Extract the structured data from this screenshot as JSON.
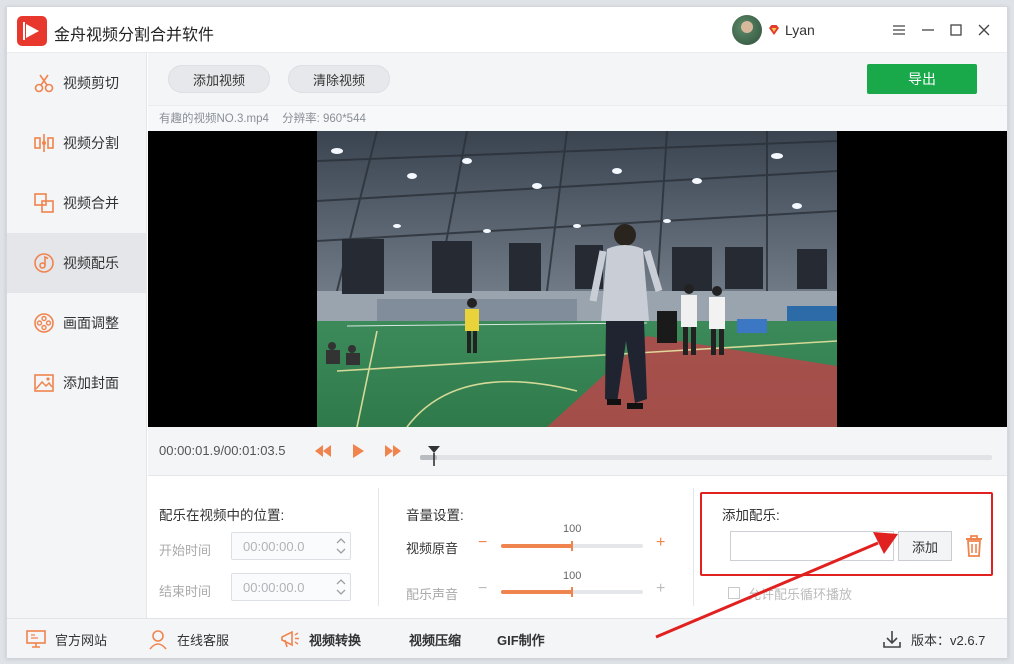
{
  "app": {
    "title": "金舟视频分割合并软件",
    "username": "Lyan"
  },
  "sidebar": {
    "items": [
      {
        "label": "视频剪切",
        "icon": "scissors-icon"
      },
      {
        "label": "视频分割",
        "icon": "split-icon"
      },
      {
        "label": "视频合并",
        "icon": "merge-icon"
      },
      {
        "label": "视频配乐",
        "icon": "music-note-icon",
        "active": true
      },
      {
        "label": "画面调整",
        "icon": "film-reel-icon"
      },
      {
        "label": "添加封面",
        "icon": "image-icon"
      }
    ]
  },
  "toolbar": {
    "add_video": "添加视频",
    "clear_video": "清除视频",
    "export": "导出"
  },
  "file_info": {
    "name": "有趣的视频NO.3.mp4",
    "resolution": "分辨率: 960*544"
  },
  "player": {
    "timecode": "00:00:01.9/00:01:03.5",
    "progress": 0.03
  },
  "position_panel": {
    "title": "配乐在视频中的位置:",
    "start_label": "开始时间",
    "start_value": "00:00:00.0",
    "end_label": "结束时间",
    "end_value": "00:00:00.0"
  },
  "volume_panel": {
    "title": "音量设置:",
    "original_label": "视频原音",
    "original_value": "100",
    "music_label": "配乐声音",
    "music_value": "100",
    "minus": "−",
    "plus": "+"
  },
  "music_panel": {
    "title": "添加配乐:",
    "input_value": "",
    "add_button": "添加",
    "loop_label": "允许配乐循环播放"
  },
  "footer": {
    "website": "官方网站",
    "support": "在线客服",
    "convert": "视频转换",
    "compress": "视频压缩",
    "gif": "GIF制作",
    "version": "版本：v2.6.7"
  },
  "colors": {
    "accent": "#f0844e",
    "export_green": "#19a84a",
    "highlight_red": "#e0211f",
    "logo_red": "#e8382e"
  }
}
